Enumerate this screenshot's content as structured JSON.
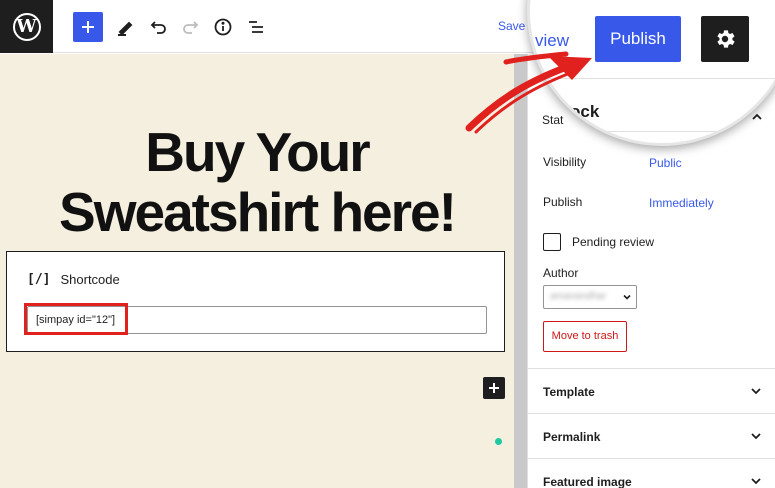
{
  "toolbar": {
    "logo_letter": "W",
    "save_draft_label": "Save d",
    "preview_label": "view",
    "publish_label": "Publish"
  },
  "canvas": {
    "headline_line1": "Buy Your",
    "headline_line2": "Sweatshirt here!",
    "shortcode": {
      "icon_text": "[/]",
      "title": "Shortcode",
      "value": "[simpay id=\"12\"]"
    }
  },
  "sidebar": {
    "tab_label": "Block",
    "status_label": "Stat",
    "rows": [
      {
        "label": "Visibility",
        "value": "Public"
      },
      {
        "label": "Publish",
        "value": "Immediately"
      }
    ],
    "pending_review_label": "Pending review",
    "author_label": "Author",
    "author_value": "amanandhar",
    "trash_label": "Move to trash",
    "panels": [
      {
        "title": "Template"
      },
      {
        "title": "Permalink"
      },
      {
        "title": "Featured image"
      }
    ]
  },
  "colors": {
    "accent": "#3858e9",
    "canvas_bg": "#f5efe0",
    "annotation_red": "#e0211d",
    "trash_red": "#cc1818",
    "dark": "#1e1e1e"
  },
  "icons": [
    "wordpress-logo-icon",
    "plus-icon",
    "pencil-icon",
    "undo-icon",
    "redo-icon",
    "info-icon",
    "list-view-icon",
    "gear-icon",
    "close-icon",
    "chevron-up-icon",
    "chevron-down-icon",
    "block-inserter-icon",
    "annotation-arrow-icon"
  ]
}
